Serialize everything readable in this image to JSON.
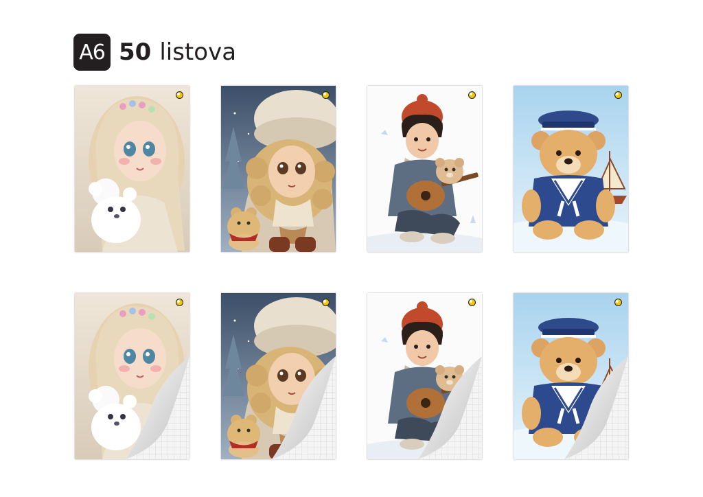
{
  "header": {
    "format_badge": "A6",
    "sheet_count": "50",
    "sheet_word": "listova"
  },
  "covers": [
    {
      "design": "girl-with-white-teddy",
      "variant": "front"
    },
    {
      "design": "curly-girl-with-bear",
      "variant": "front"
    },
    {
      "design": "boy-with-guitar-and-teddy",
      "variant": "front"
    },
    {
      "design": "sailor-teddy-bear",
      "variant": "front"
    },
    {
      "design": "girl-with-white-teddy",
      "variant": "page-curl-grid"
    },
    {
      "design": "curly-girl-with-bear",
      "variant": "page-curl-grid"
    },
    {
      "design": "boy-with-guitar-and-teddy",
      "variant": "page-curl-grid"
    },
    {
      "design": "sailor-teddy-bear",
      "variant": "page-curl-grid"
    }
  ],
  "colors": {
    "badge": "#231f20",
    "brand_dot": "#f2c600"
  }
}
